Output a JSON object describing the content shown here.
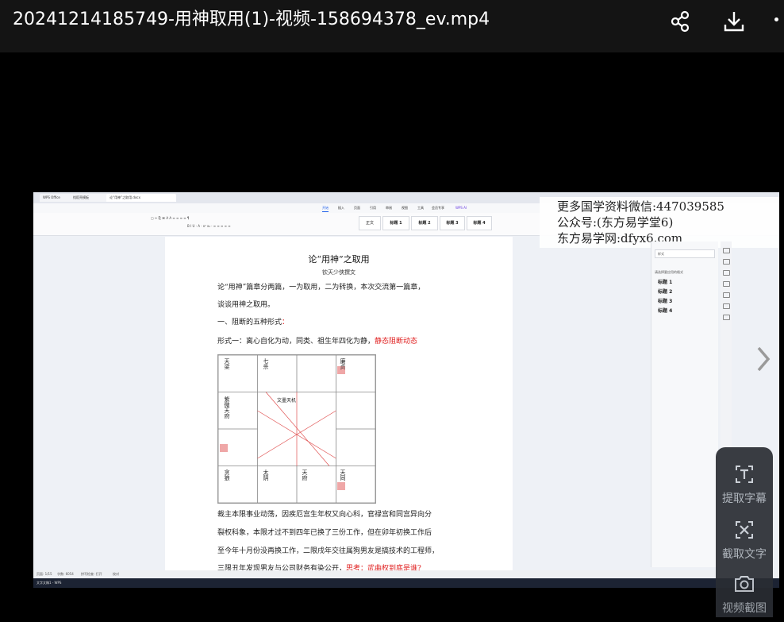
{
  "header": {
    "title": "20241214185749-用神取用(1)-视频-158694378_ev.mp4"
  },
  "watermark": {
    "line1": "更多国学资料微信:447039585",
    "line2": "公众号:(东方易学堂6)",
    "line3": "东方易学网:dfyx6.com"
  },
  "doc": {
    "title": "论“用神”之取用",
    "author": "钦天少侠撰文",
    "p1": "论“用神”篇章分两篇，一为取用，二为转换，本次交流第一篇章，",
    "p2": "谈谈用神之取用。",
    "p3_prefix": "一、阻断的五种形式",
    "p3_colon": "：",
    "p4": "形式一：离心自化为动，同类、祖生年四化为静，",
    "p4_red": "静态阻断动态",
    "p5": "裁主本限事业动荡，因疾厄宫生年权又向心科，官禄宫和同宫异向分",
    "p6": "裂权科象，本限才过不到四年已换了三份工作，但在卯年初换工作后",
    "p7": "至今年十月份没再换工作，二限戌年交往属狗男友是搞技术的工程师，",
    "p8": "三限丑年发现男友与公司财务有染公开，",
    "p8_red": "思考：武曲权到底是谁?"
  },
  "chart": {
    "cells": [
      "天梁",
      "七杀",
      "",
      "廉贞",
      "",
      "",
      "紫微天府",
      "",
      "",
      "",
      "天同",
      "太阴",
      "天府",
      "太阳",
      "贪狼",
      "天机"
    ],
    "center": "文墨天机"
  },
  "side_panel": {
    "search": "样式",
    "headings": [
      "标题 1",
      "标题 2",
      "标题 3",
      "标题 4"
    ],
    "label": "请选择要应用的格式"
  },
  "wps": {
    "tabs": [
      "WPS Office",
      "找稻壳模板",
      "论“用神”之取用.docx"
    ],
    "menu": [
      "开始",
      "插入",
      "页面",
      "引用",
      "审阅",
      "视图",
      "工具",
      "会员专享",
      "WPS AI"
    ],
    "styles": [
      "正文",
      "标题 1",
      "标题 2",
      "标题 3",
      "标题 4"
    ],
    "status": [
      "页面: 1/15",
      "字数: 6054",
      "拼写检查: 打开",
      "校对"
    ],
    "taskbar_item": "文字文稿1 - WPS"
  },
  "tools": {
    "extract_subtitle": "提取字幕",
    "capture_text": "截取文字",
    "video_screenshot": "视频截图"
  }
}
